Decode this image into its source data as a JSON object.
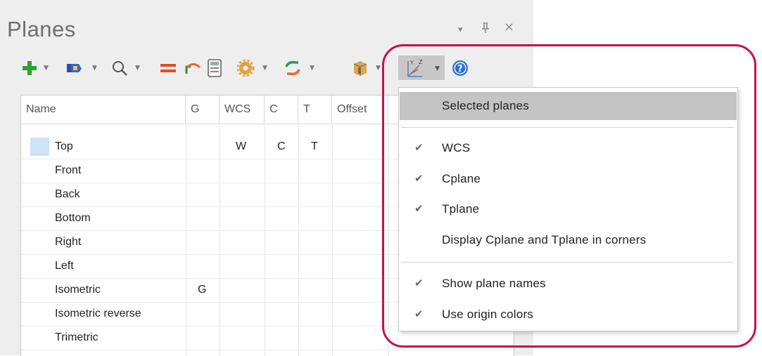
{
  "panel": {
    "title": "Planes",
    "window_buttons": {
      "menu": "▾",
      "pin": "ᵽ",
      "close": "×"
    }
  },
  "toolbar": {
    "icons": [
      "add-icon",
      "view-icon",
      "search-icon",
      "equals-icon",
      "undo-icon",
      "calculator-icon",
      "gear-icon",
      "refresh-icon",
      "cube-icon",
      "axes-display-icon",
      "help-icon"
    ]
  },
  "grid": {
    "columns": [
      "Name",
      "G",
      "WCS",
      "C",
      "T",
      "Offset"
    ],
    "rows": [
      {
        "name": "Top",
        "g": "",
        "wcs": "W",
        "c": "C",
        "t": "T"
      },
      {
        "name": "Front",
        "g": "",
        "wcs": "",
        "c": "",
        "t": ""
      },
      {
        "name": "Back",
        "g": "",
        "wcs": "",
        "c": "",
        "t": ""
      },
      {
        "name": "Bottom",
        "g": "",
        "wcs": "",
        "c": "",
        "t": ""
      },
      {
        "name": "Right",
        "g": "",
        "wcs": "",
        "c": "",
        "t": ""
      },
      {
        "name": "Left",
        "g": "",
        "wcs": "",
        "c": "",
        "t": ""
      },
      {
        "name": "Isometric",
        "g": "G",
        "wcs": "",
        "c": "",
        "t": ""
      },
      {
        "name": "Isometric reverse",
        "g": "",
        "wcs": "",
        "c": "",
        "t": ""
      },
      {
        "name": "Trimetric",
        "g": "",
        "wcs": "",
        "c": "",
        "t": ""
      }
    ]
  },
  "menu": {
    "items": [
      {
        "label": "Selected planes",
        "checked": false
      },
      {
        "label": "WCS",
        "checked": true
      },
      {
        "label": "Cplane",
        "checked": true
      },
      {
        "label": "Tplane",
        "checked": true
      },
      {
        "label": "Display Cplane and Tplane in corners",
        "checked": false
      },
      {
        "label": "Show plane names",
        "checked": true
      },
      {
        "label": "Use origin colors",
        "checked": true
      }
    ],
    "check_glyph": "✔"
  },
  "colors": {
    "accent_ring": "#c2134a",
    "menu_hover": "#c4c4c4",
    "selected_row_marker": "#cfe3f7"
  }
}
